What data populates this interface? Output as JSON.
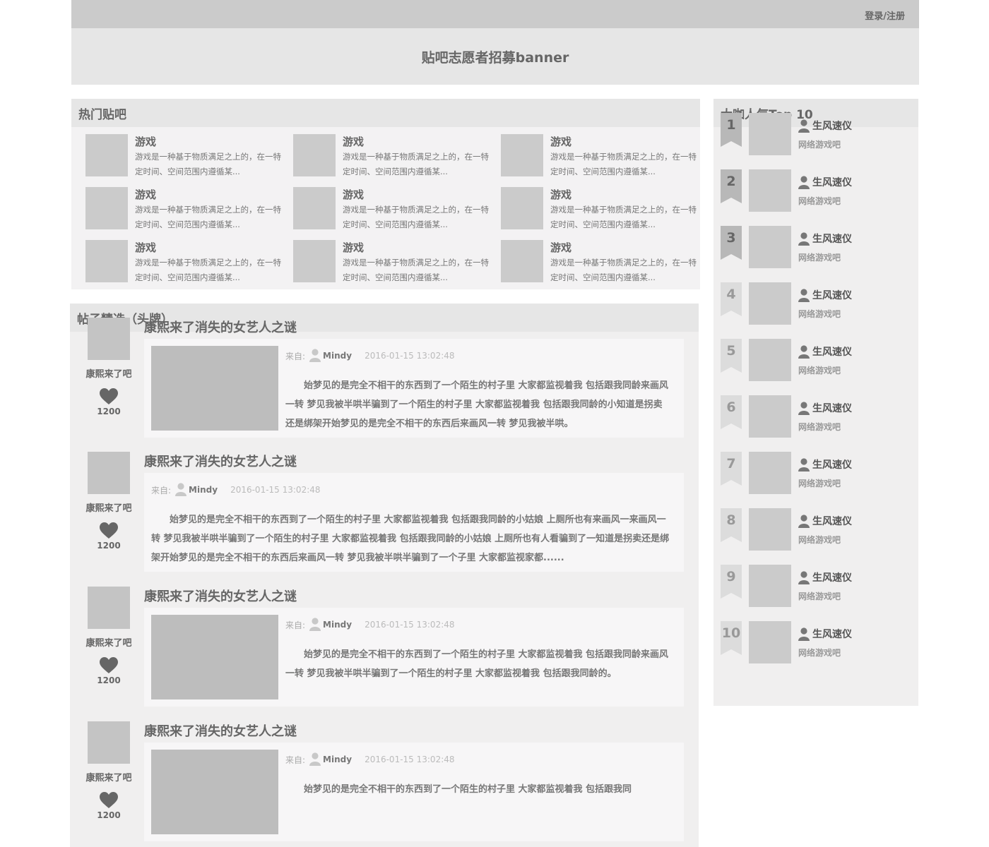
{
  "header": {
    "login_label": "登录/注册"
  },
  "banner": {
    "text": "贴吧志愿者招募banner"
  },
  "hot": {
    "title": "热门贴吧",
    "items": [
      {
        "name": "游戏",
        "desc": "游戏是一种基于物质满足之上的，在一特定时间、空间范围内遵循某..."
      },
      {
        "name": "游戏",
        "desc": "游戏是一种基于物质满足之上的，在一特定时间、空间范围内遵循某..."
      },
      {
        "name": "游戏",
        "desc": "游戏是一种基于物质满足之上的，在一特定时间、空间范围内遵循某..."
      },
      {
        "name": "游戏",
        "desc": "游戏是一种基于物质满足之上的，在一特定时间、空间范围内遵循某..."
      },
      {
        "name": "游戏",
        "desc": "游戏是一种基于物质满足之上的，在一特定时间、空间范围内遵循某..."
      },
      {
        "name": "游戏",
        "desc": "游戏是一种基于物质满足之上的，在一特定时间、空间范围内遵循某..."
      },
      {
        "name": "游戏",
        "desc": "游戏是一种基于物质满足之上的，在一特定时间、空间范围内遵循某..."
      },
      {
        "name": "游戏",
        "desc": "游戏是一种基于物质满足之上的，在一特定时间、空间范围内遵循某..."
      },
      {
        "name": "游戏",
        "desc": "游戏是一种基于物质满足之上的，在一特定时间、空间范围内遵循某..."
      }
    ]
  },
  "posts": {
    "title": "帖子精选（头牌）",
    "items": [
      {
        "forum": "康熙来了吧",
        "likes": "1200",
        "title": "康熙来了消失的女艺人之谜",
        "has_image": true,
        "from_label": "来自:",
        "user": "Mindy",
        "date": "2016-01-15 13:02:48",
        "body": "始梦见的是完全不相干的东西到了一个陌生的村子里 大家都监视着我 包括跟我同龄来画风一转 梦见我被半哄半骗到了一个陌生的村子里 大家都监视着我 包括跟我同龄的小知道是拐卖还是绑架开始梦见的是完全不相干的东西后来画风一转 梦见我被半哄。"
      },
      {
        "forum": "康熙来了吧",
        "likes": "1200",
        "title": "康熙来了消失的女艺人之谜",
        "has_image": false,
        "from_label": "来自:",
        "user": "Mindy",
        "date": "2016-01-15 13:02:48",
        "body": "始梦见的是完全不相干的东西到了一个陌生的村子里 大家都监视着我 包括跟我同龄的小姑娘 上厕所也有来画风一来画风一转 梦见我被半哄半骗到了一个陌生的村子里 大家都监视着我 包括跟我同龄的小姑娘 上厕所也有人看骗到了一知道是拐卖还是绑架开始梦见的是完全不相干的东西后来画风一转 梦见我被半哄半骗到了一个子里 大家都监视家都......"
      },
      {
        "forum": "康熙来了吧",
        "likes": "1200",
        "title": "康熙来了消失的女艺人之谜",
        "has_image": true,
        "from_label": "来自:",
        "user": "Mindy",
        "date": "2016-01-15 13:02:48",
        "body": "始梦见的是完全不相干的东西到了一个陌生的村子里 大家都监视着我 包括跟我同龄来画风一转 梦见我被半哄半骗到了一个陌生的村子里 大家都监视着我 包括跟我同龄的。"
      },
      {
        "forum": "康熙来了吧",
        "likes": "1200",
        "title": "康熙来了消失的女艺人之谜",
        "has_image": true,
        "from_label": "来自:",
        "user": "Mindy",
        "date": "2016-01-15 13:02:48",
        "body": "始梦见的是完全不相干的东西到了一个陌生的村子里 大家都监视着我 包括跟我同"
      }
    ]
  },
  "top10": {
    "title": "大咖人气Top 10",
    "items": [
      {
        "rank": "1",
        "name": "生风速仪",
        "forum": "网络游戏吧"
      },
      {
        "rank": "2",
        "name": "生风速仪",
        "forum": "网络游戏吧"
      },
      {
        "rank": "3",
        "name": "生风速仪",
        "forum": "网络游戏吧"
      },
      {
        "rank": "4",
        "name": "生风速仪",
        "forum": "网络游戏吧"
      },
      {
        "rank": "5",
        "name": "生风速仪",
        "forum": "网络游戏吧"
      },
      {
        "rank": "6",
        "name": "生风速仪",
        "forum": "网络游戏吧"
      },
      {
        "rank": "7",
        "name": "生风速仪",
        "forum": "网络游戏吧"
      },
      {
        "rank": "8",
        "name": "生风速仪",
        "forum": "网络游戏吧"
      },
      {
        "rank": "9",
        "name": "生风速仪",
        "forum": "网络游戏吧"
      },
      {
        "rank": "10",
        "name": "生风速仪",
        "forum": "网络游戏吧"
      }
    ]
  },
  "colors": {
    "ribbon_top3": "#b8b8b8",
    "ribbon_rest": "#dcdcdc",
    "rank_top3": "#666666",
    "rank_rest": "#999999"
  },
  "icons": {
    "like": "heart-icon",
    "user": "user-icon",
    "rank": "ribbon-icon"
  }
}
